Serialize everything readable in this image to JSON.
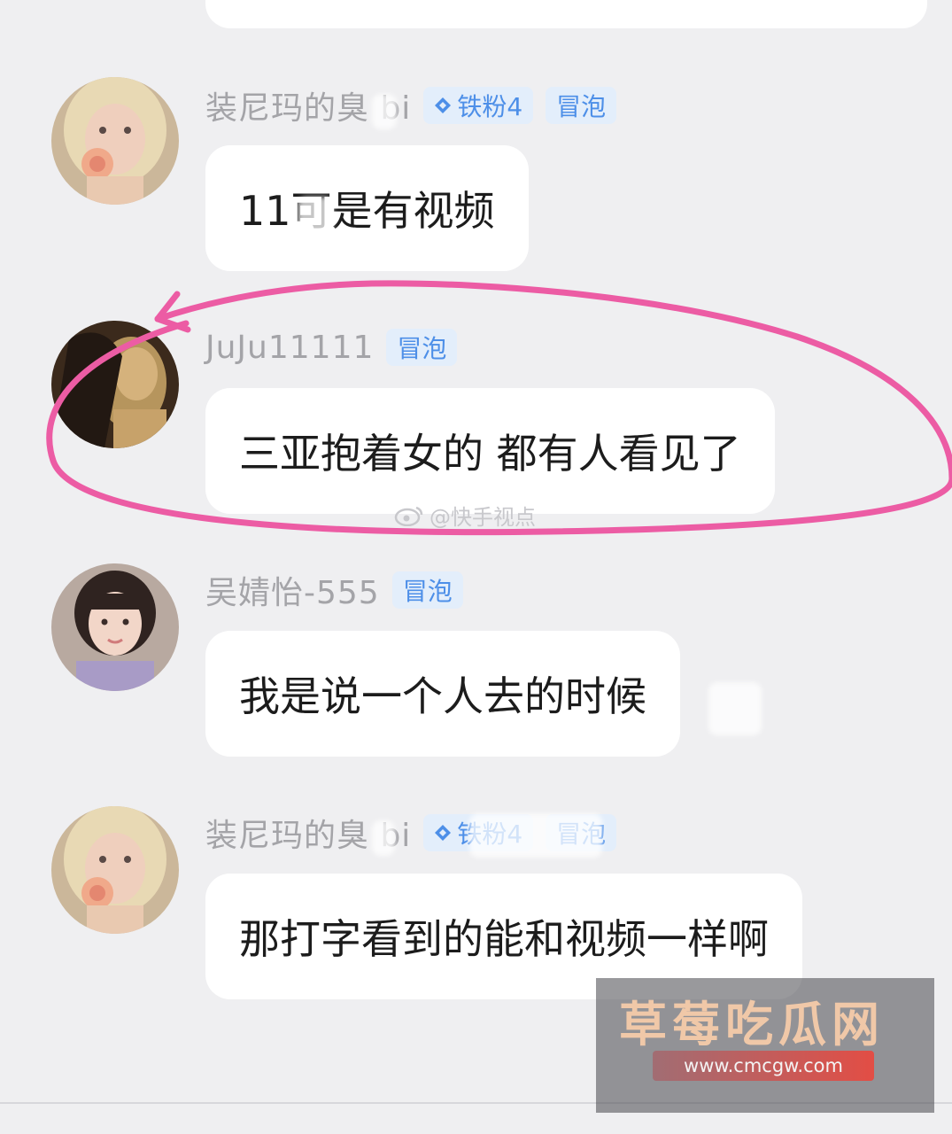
{
  "messages": [
    {
      "username": "装尼玛的臭 bi",
      "badges": [
        "铁粉4",
        "冒泡"
      ],
      "text": "11可是有视频",
      "avatar": "avatar-blonde-rose"
    },
    {
      "username": "JuJu11111",
      "badges": [
        "冒泡"
      ],
      "text": "三亚抱着女的 都有人看见了",
      "avatar": "avatar-dark-hair"
    },
    {
      "username": "吴婧怡-555",
      "badges": [
        "冒泡"
      ],
      "text": "我是说一个人去的时候",
      "avatar": "avatar-girl-bangs"
    },
    {
      "username": "装尼玛的臭 bi",
      "badges": [
        "铁粉4",
        "冒泡"
      ],
      "text": "那打字看到的能和视频一样啊",
      "avatar": "avatar-blonde-rose"
    }
  ],
  "watermarks": {
    "weibo": "@快手视点",
    "site_name": "草莓吃瓜网",
    "site_url": "www.cmcgw.com"
  },
  "colors": {
    "background": "#efeff1",
    "bubble": "#ffffff",
    "badge_text": "#4d8fe8",
    "badge_bg": "#e3eefb",
    "username": "#a4a4a8",
    "annotation": "#ec5ca4"
  },
  "icons": {
    "badge_fan": "diamond-icon",
    "weibo": "weibo-eye-icon"
  }
}
